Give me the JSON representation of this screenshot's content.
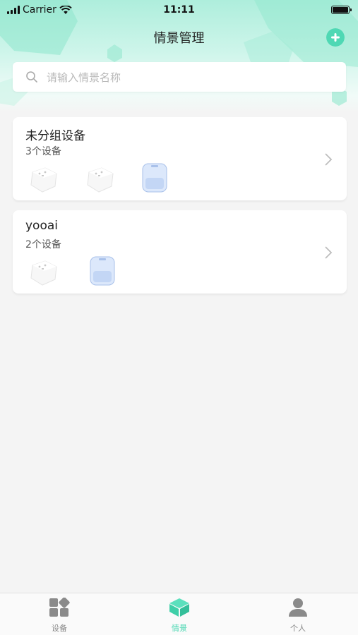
{
  "status_bar": {
    "carrier": "Carrier",
    "time": "11:11"
  },
  "header": {
    "title": "情景管理"
  },
  "search": {
    "placeholder": "请输入情景名称"
  },
  "groups": [
    {
      "name": "未分组设备",
      "count": "3个设备",
      "devices": [
        "smart-plug",
        "smart-plug",
        "blue-charger"
      ]
    },
    {
      "name": "yooai",
      "count": "2个设备",
      "devices": [
        "smart-plug",
        "blue-charger"
      ]
    }
  ],
  "tabbar": {
    "tabs": [
      {
        "label": "设备",
        "icon": "devices-grid-icon",
        "active": false
      },
      {
        "label": "情景",
        "icon": "scene-cube-icon",
        "active": true
      },
      {
        "label": "个人",
        "icon": "person-icon",
        "active": false
      }
    ]
  },
  "colors": {
    "accent": "#4fd8b4",
    "inactive": "#888888"
  }
}
